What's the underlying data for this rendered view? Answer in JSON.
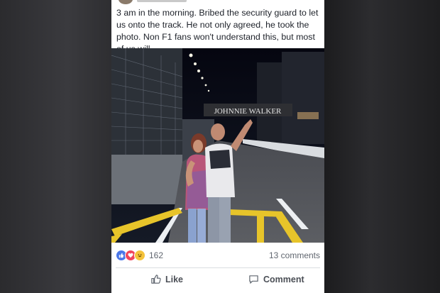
{
  "post": {
    "text": "3 am in the morning.  Bribed the security guard to let us onto the track. He not only agreed, he took the photo. Non F1 fans won't understand this, but most of us will",
    "photo_sign": "JOHNNIE WALKER"
  },
  "reactions": {
    "icons": [
      "like-reaction-icon",
      "love-reaction-icon",
      "haha-reaction-icon"
    ],
    "count": "162",
    "comments": "13 comments"
  },
  "actions": {
    "like_label": "Like",
    "comment_label": "Comment"
  },
  "colors": {
    "like_blue": "#4a76e8",
    "love_red": "#f0455a",
    "haha_yellow": "#f5c33b",
    "text_gray": "#616770"
  }
}
